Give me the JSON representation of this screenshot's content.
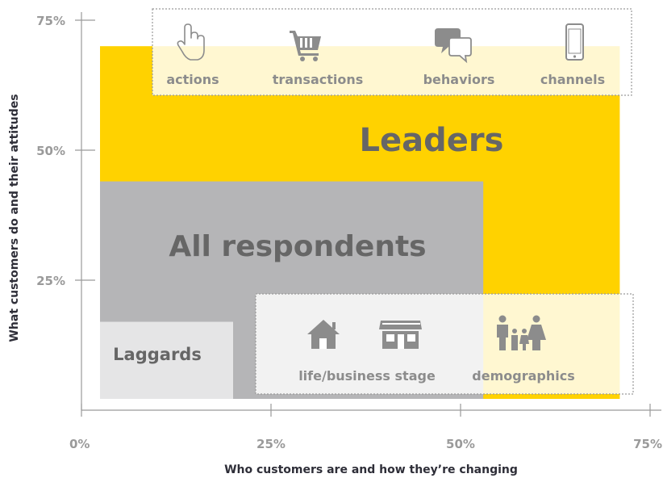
{
  "chart_data": {
    "type": "area",
    "xlabel": "Who customers are and how they’re changing",
    "ylabel": "What customers do and their attitudes",
    "xlim": [
      0,
      75
    ],
    "ylim": [
      0,
      75
    ],
    "x_ticks": [
      "0%",
      "25%",
      "50%",
      "75%"
    ],
    "y_ticks": [
      "25%",
      "50%",
      "75%"
    ],
    "series": [
      {
        "name": "Leaders",
        "x": 71,
        "y": 70,
        "color": "#FFD200"
      },
      {
        "name": "All respondents",
        "x": 53,
        "y": 44,
        "color": "#B5B5B7"
      },
      {
        "name": "Laggards",
        "x": 20,
        "y": 17,
        "color": "#E5E5E6"
      }
    ],
    "annotations": {
      "attitudes_box": [
        "actions",
        "transactions",
        "behaviors",
        "channels"
      ],
      "identity_box": [
        "life/business stage",
        "demographics"
      ]
    },
    "icons": [
      "hand-pointer-icon",
      "shopping-cart-icon",
      "chat-bubbles-icon",
      "mobile-phone-icon",
      "house-icon",
      "storefront-icon",
      "family-icon"
    ]
  }
}
